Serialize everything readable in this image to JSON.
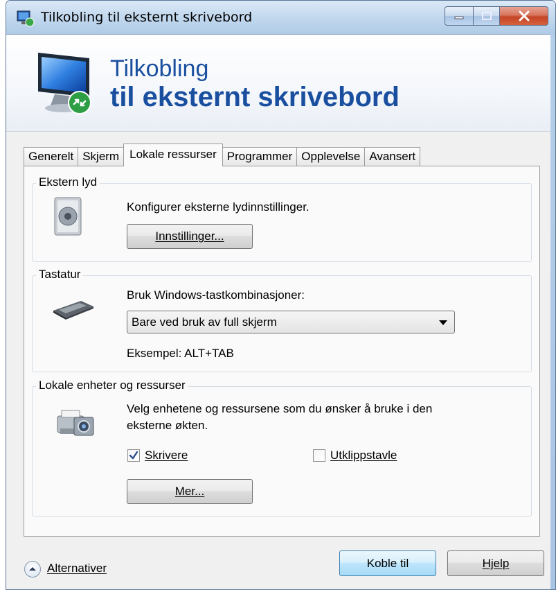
{
  "window": {
    "title": "Tilkobling til eksternt skrivebord"
  },
  "banner": {
    "line1": "Tilkobling",
    "line2": "til eksternt skrivebord"
  },
  "tabs": [
    {
      "label": "Generelt",
      "active": false
    },
    {
      "label": "Skjerm",
      "active": false
    },
    {
      "label": "Lokale ressurser",
      "active": true
    },
    {
      "label": "Programmer",
      "active": false
    },
    {
      "label": "Opplevelse",
      "active": false
    },
    {
      "label": "Avansert",
      "active": false
    }
  ],
  "audio": {
    "group_label": "Ekstern lyd",
    "description": "Konfigurer eksterne lydinnstillinger.",
    "settings_button": "Innstillinger..."
  },
  "keyboard": {
    "group_label": "Tastatur",
    "description": "Bruk Windows-tastkombinasjoner:",
    "selected_option": "Bare ved bruk av full skjerm",
    "example": "Eksempel: ALT+TAB"
  },
  "local_devices": {
    "group_label": "Lokale enheter og ressurser",
    "description_line1": "Velg enhetene og ressursene som du ønsker å bruke i den",
    "description_line2": "eksterne økten.",
    "printers": {
      "label": "Skrivere",
      "checked": true
    },
    "clipboard": {
      "label": "Utklippstavle",
      "checked": false
    },
    "more_button": "Mer..."
  },
  "footer": {
    "options_label": "Alternativer",
    "connect_button": "Koble til",
    "help_button": "Hjelp"
  },
  "colors": {
    "banner_text": "#1a4fa0",
    "close_button": "#c44427",
    "primary_button_border": "#3c7fb1"
  },
  "icons": [
    "rdp-app-icon",
    "rdp-monitor-icon",
    "speaker-icon",
    "keyboard-icon",
    "printer-camera-icon",
    "chevron-up-icon"
  ]
}
